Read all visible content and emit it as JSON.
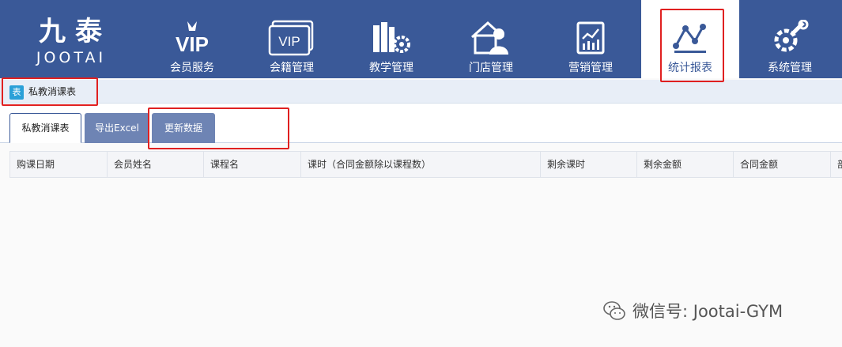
{
  "logo": {
    "cn": "九泰",
    "en": "JOOTAI"
  },
  "nav": [
    {
      "label": "会员服务",
      "icon": "vip-icon",
      "glyph": "VIP"
    },
    {
      "label": "会籍管理",
      "icon": "vip-card-icon",
      "glyph": "VIP"
    },
    {
      "label": "教学管理",
      "icon": "books-gear-icon"
    },
    {
      "label": "门店管理",
      "icon": "store-user-icon"
    },
    {
      "label": "营销管理",
      "icon": "chart-doc-icon"
    },
    {
      "label": "统计报表",
      "icon": "stats-graph-icon",
      "active": true
    },
    {
      "label": "系统管理",
      "icon": "wrench-gear-icon"
    }
  ],
  "breadcrumb": {
    "icon_glyph": "表",
    "title": "私教消课表"
  },
  "tabs": [
    {
      "label": "私教消课表",
      "active": true
    },
    {
      "label": "导出Excel"
    },
    {
      "label": "更新数据"
    }
  ],
  "table": {
    "headers": [
      "购课日期",
      "会员姓名",
      "课程名",
      "课时（合同金额除以课程数）",
      "剩余课时",
      "剩余金额",
      "合同金额",
      "部"
    ]
  },
  "watermark": {
    "text": "微信号: Jootai-GYM"
  },
  "colors": {
    "nav_bg": "#3a5998",
    "highlight": "#e02020",
    "tab_inactive": "#6e84b4"
  }
}
